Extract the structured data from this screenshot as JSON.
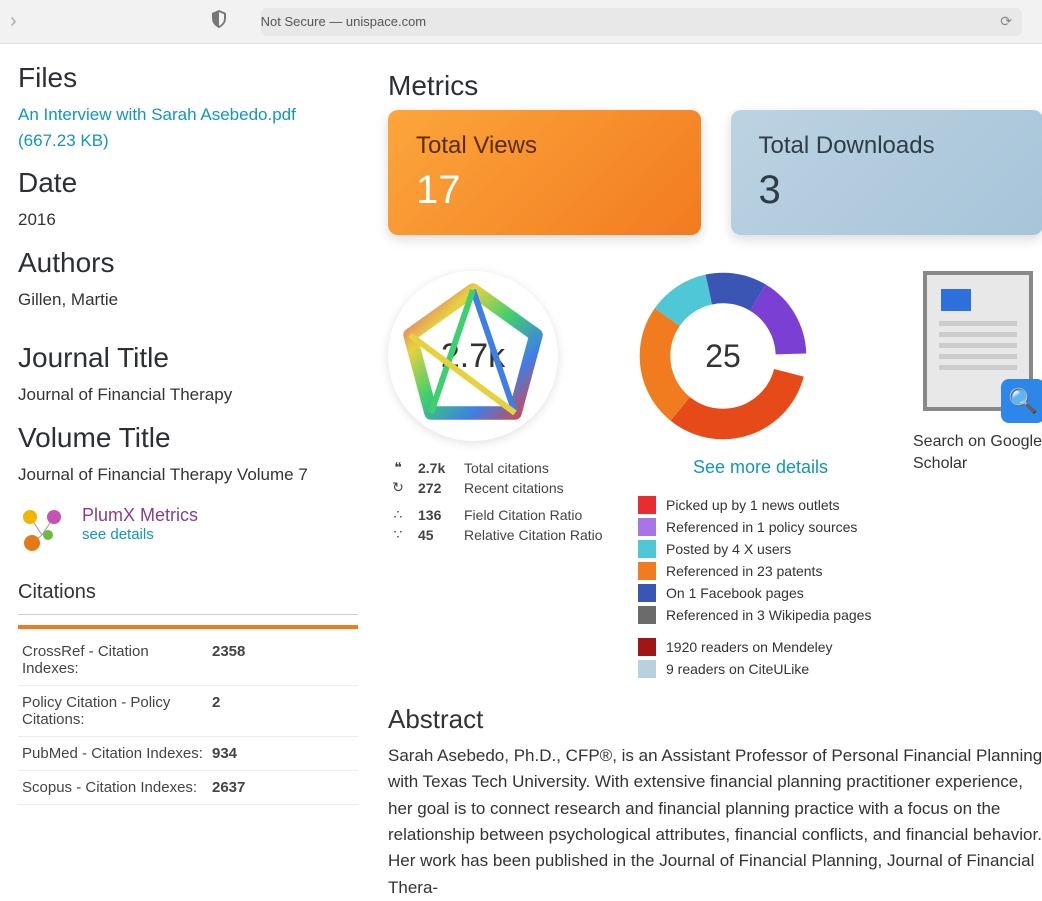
{
  "browser": {
    "address": "Not Secure — unispace.com"
  },
  "sidebar": {
    "files_heading": "Files",
    "file_link": "An Interview with Sarah Asebedo.pdf (667.23 KB)",
    "date_heading": "Date",
    "date_value": "2016",
    "authors_heading": "Authors",
    "authors_value": "Gillen, Martie",
    "journal_heading": "Journal Title",
    "journal_value": "Journal of Financial Therapy",
    "volume_heading": "Volume Title",
    "volume_value": "Journal of Financial Therapy Volume 7",
    "plumx": {
      "title": "PlumX Metrics",
      "see": "see details"
    },
    "citations_heading": "Citations",
    "citations": [
      {
        "label": "CrossRef - Citation Indexes:",
        "value": "2358"
      },
      {
        "label": "Policy Citation - Policy Citations:",
        "value": "2"
      },
      {
        "label": "PubMed - Citation Indexes:",
        "value": "934"
      },
      {
        "label": "Scopus - Citation Indexes:",
        "value": "2637"
      }
    ]
  },
  "main": {
    "metrics_heading": "Metrics",
    "views": {
      "label": "Total Views",
      "value": "17"
    },
    "downloads": {
      "label": "Total Downloads",
      "value": "3"
    },
    "dimensions_score": "2.7k",
    "altmetric_score": "25",
    "see_more": "See more details",
    "scholar_label": "Search on Google Scholar",
    "dim_rows": [
      {
        "icon": "❝",
        "value": "2.7k",
        "label": "Total citations"
      },
      {
        "icon": "↻",
        "value": "272",
        "label": "Recent citations"
      },
      {
        "icon": "∴",
        "value": "136",
        "label": "Field Citation Ratio"
      },
      {
        "icon": "∵",
        "value": "45",
        "label": "Relative Citation Ratio"
      }
    ],
    "alt_rows": [
      {
        "color": "#e62e2e",
        "text": "Picked up by 1 news outlets"
      },
      {
        "color": "#a974e6",
        "text": "Referenced in 1 policy sources"
      },
      {
        "color": "#4fc7d6",
        "text": "Posted by 4 X users"
      },
      {
        "color": "#f07c1f",
        "text": "Referenced in 23 patents"
      },
      {
        "color": "#3b55b5",
        "text": "On 1 Facebook pages"
      },
      {
        "color": "#6b6b6b",
        "text": "Referenced in 3 Wikipedia pages"
      }
    ],
    "alt_rows2": [
      {
        "color": "#a01616",
        "text": "1920 readers on Mendeley"
      },
      {
        "color": "#b8d0df",
        "text": "9 readers on CiteULike"
      }
    ],
    "abstract_heading": "Abstract",
    "abstract_text": "Sarah Asebedo, Ph.D., CFP®, is an Assistant Professor of Personal Financial Planning with Texas Tech University. With extensive financial planning practitioner experience, her goal is to connect research and financial planning practice with a focus on the relationship between psychological attributes, financial conflicts, and financial behavior. Her work has been published in the Journal of Financial Planning, Journal of Financial Thera-"
  }
}
